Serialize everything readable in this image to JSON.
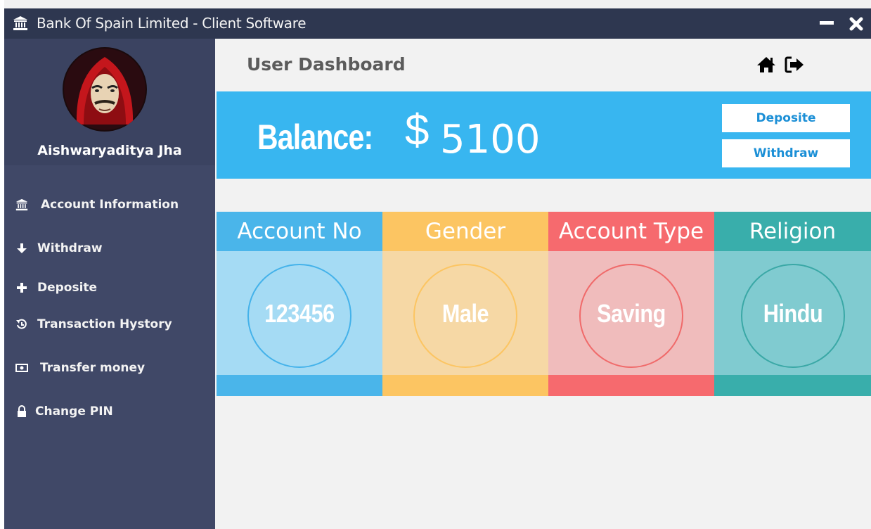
{
  "window": {
    "title": "Bank Of Spain Limited - Client Software",
    "icons": {
      "app": "bank-icon",
      "minimize": "minimize-icon",
      "close": "close-icon"
    }
  },
  "sidebar": {
    "user_name": "Aishwaryaditya Jha",
    "items": [
      {
        "label": "Account Information",
        "icon": "bank-icon"
      },
      {
        "label": "Withdraw",
        "icon": "arrow-down-icon"
      },
      {
        "label": "Deposite",
        "icon": "plus-icon"
      },
      {
        "label": "Transaction Hystory",
        "icon": "history-icon"
      },
      {
        "label": "Transfer money",
        "icon": "money-icon"
      },
      {
        "label": "Change PIN",
        "icon": "lock-icon"
      }
    ]
  },
  "header": {
    "title": "User Dashboard",
    "icons": {
      "home": "home-icon",
      "logout": "sign-out-icon"
    }
  },
  "balance": {
    "label": "Balance:",
    "currency": "$",
    "amount": "5100",
    "deposit_label": "Deposite",
    "withdraw_label": "Withdraw"
  },
  "cards": [
    {
      "title": "Account No",
      "value": "123456",
      "head_color": "#4ab5ea",
      "body_color": "#a5dbf4",
      "ring_color": "#44b2ea"
    },
    {
      "title": "Gender",
      "value": "Male",
      "head_color": "#fcc562",
      "body_color": "#f6d8a5",
      "ring_color": "#fcc562"
    },
    {
      "title": "Account Type",
      "value": "Saving",
      "head_color": "#f66a6e",
      "body_color": "#f0bcbc",
      "ring_color": "#f06a6a"
    },
    {
      "title": "Religion",
      "value": "Hindu",
      "head_color": "#39aeab",
      "body_color": "#80cbd0",
      "ring_color": "#3aa8a6"
    }
  ],
  "colors": {
    "titlebar": "#2e3750",
    "sidebar": "#404867",
    "banner": "#38b6f0",
    "button_text": "#1b8fd6"
  }
}
